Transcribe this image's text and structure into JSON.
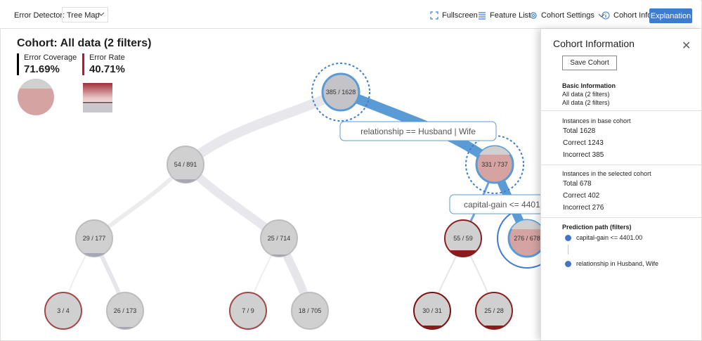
{
  "toolbar": {
    "detector_label": "Error Detector:",
    "view_selected": "Tree Map",
    "fullscreen": "Fullscreen",
    "feature_list": "Feature List",
    "cohort_settings": "Cohort Settings",
    "cohort_info": "Cohort Info",
    "explanation": "Explanation",
    "accent_color": "#3e7cd0"
  },
  "header": {
    "cohort_title": "Cohort: All data (2 filters)",
    "error_coverage_label": "Error Coverage",
    "error_coverage_value": "71.69%",
    "error_rate_label": "Error Rate",
    "error_rate_value": "40.71%"
  },
  "tree": {
    "nodes": {
      "root": "385 / 1628",
      "l1_left": "54 / 891",
      "l1_right": "331 / 737",
      "l2_a": "29 / 177",
      "l2_b": "25 / 714",
      "l2_c": "55 / 59",
      "l2_d": "276 / 678",
      "l3_a": "3 / 4",
      "l3_b": "26 / 173",
      "l3_c": "7 / 9",
      "l3_d": "18 / 705",
      "l3_e": "30 / 31",
      "l3_f": "25 / 28"
    },
    "split_labels": {
      "root_split": "relationship == Husband | Wife",
      "second_split": "capital-gain <= 4401"
    }
  },
  "panel": {
    "title": "Cohort Information",
    "save_button": "Save Cohort",
    "basic_info_heading": "Basic Information",
    "basic_info_line1": "All data (2 filters)",
    "basic_info_line2": "All data (2 filters)",
    "base_heading": "Instances in base cohort",
    "base_total": "Total 1628",
    "base_correct": "Correct 1243",
    "base_incorrect": "Incorrect 385",
    "selected_heading": "Instances in the selected cohort",
    "selected_total": "Total 678",
    "selected_correct": "Correct 402",
    "selected_incorrect": "Incorrect 276",
    "path_heading": "Prediction path (filters)",
    "path_item1": "capital-gain <= 4401.00",
    "path_item2": "relationship in Husband, Wife"
  }
}
